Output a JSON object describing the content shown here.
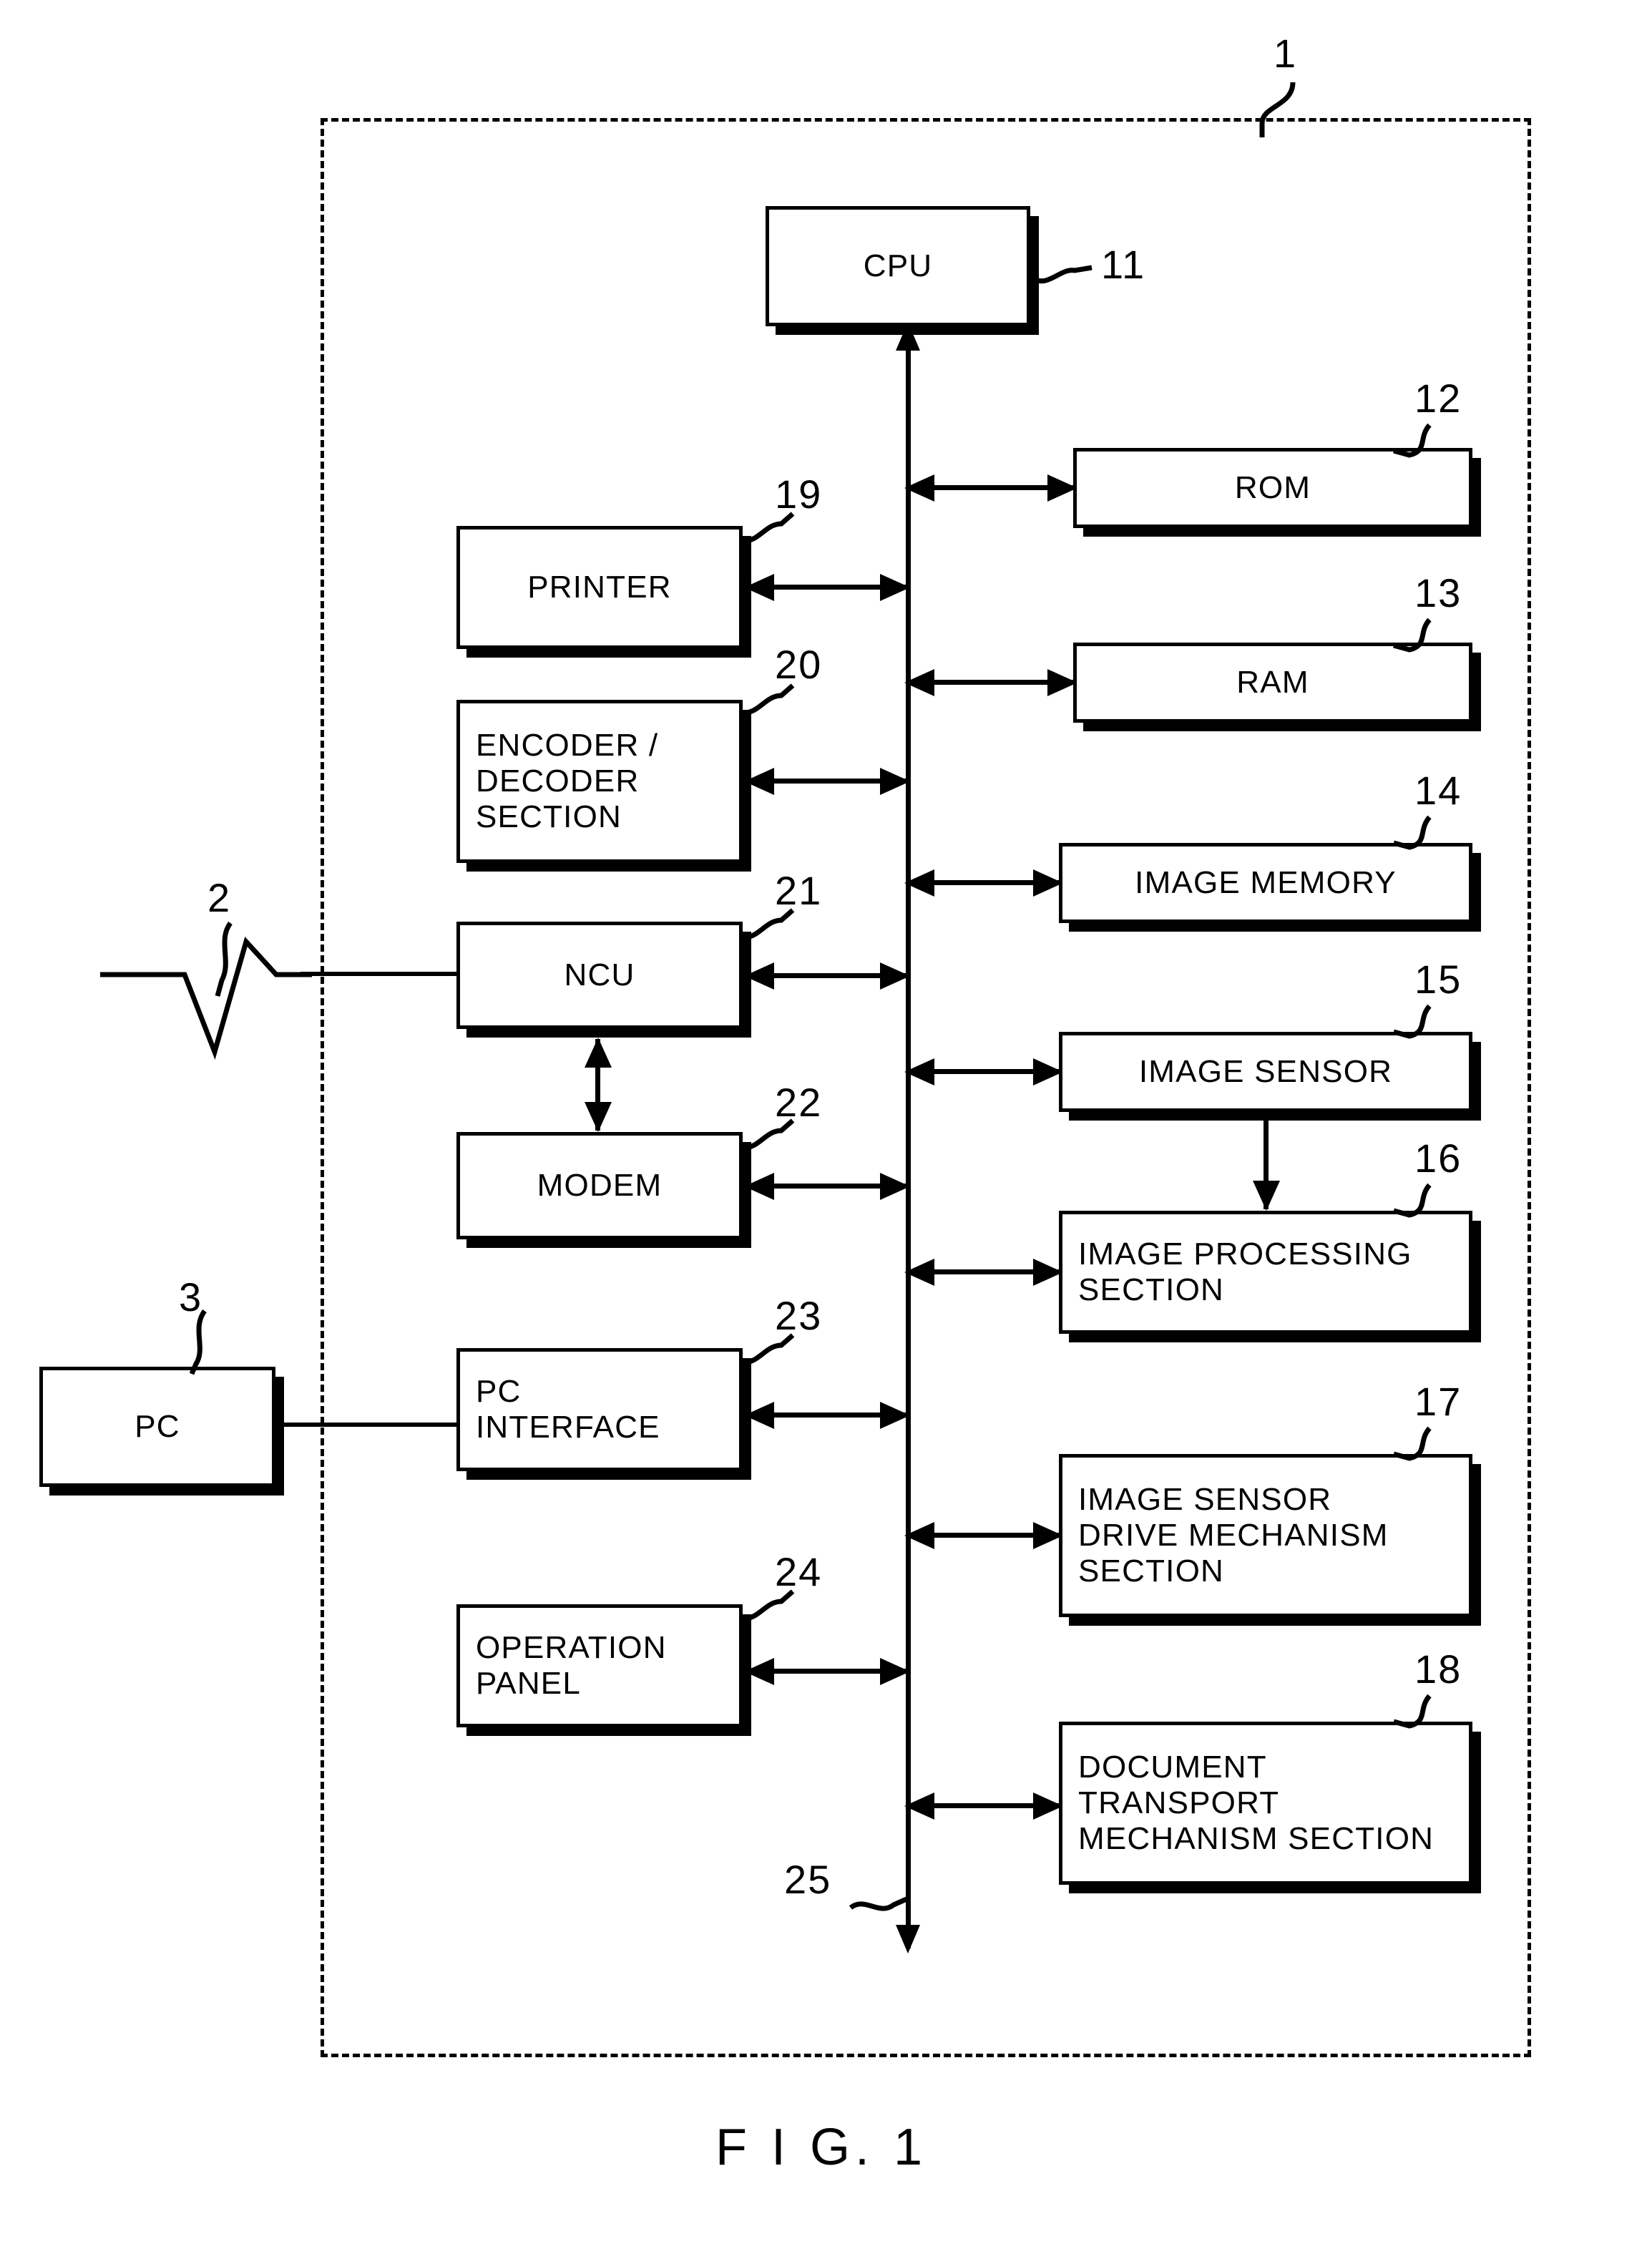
{
  "figure": {
    "caption": "F I G. 1",
    "enclosure_ref": "1"
  },
  "blocks": [
    {
      "id": "cpu",
      "label": "CPU",
      "ref": "11",
      "align": "center"
    },
    {
      "id": "rom",
      "label": "ROM",
      "ref": "12",
      "align": "center"
    },
    {
      "id": "ram",
      "label": "RAM",
      "ref": "13",
      "align": "center"
    },
    {
      "id": "image-memory",
      "label": "IMAGE MEMORY",
      "ref": "14",
      "align": "center"
    },
    {
      "id": "image-sensor",
      "label": "IMAGE SENSOR",
      "ref": "15",
      "align": "center"
    },
    {
      "id": "image-processing",
      "label": "IMAGE PROCESSING\nSECTION",
      "ref": "16",
      "align": "left"
    },
    {
      "id": "sensor-drive",
      "label": "IMAGE SENSOR\nDRIVE MECHANISM\nSECTION",
      "ref": "17",
      "align": "left"
    },
    {
      "id": "doc-transport",
      "label": "DOCUMENT\nTRANSPORT\nMECHANISM SECTION",
      "ref": "18",
      "align": "left"
    },
    {
      "id": "printer",
      "label": "PRINTER",
      "ref": "19",
      "align": "center"
    },
    {
      "id": "encoder-decoder",
      "label": "ENCODER /\nDECODER\nSECTION",
      "ref": "20",
      "align": "left"
    },
    {
      "id": "ncu",
      "label": "NCU",
      "ref": "21",
      "align": "center"
    },
    {
      "id": "modem",
      "label": "MODEM",
      "ref": "22",
      "align": "center"
    },
    {
      "id": "pc-interface",
      "label": "PC\nINTERFACE",
      "ref": "23",
      "align": "left"
    },
    {
      "id": "operation-panel",
      "label": "OPERATION\nPANEL",
      "ref": "24",
      "align": "left"
    },
    {
      "id": "pc",
      "label": "PC",
      "ref": "3",
      "align": "center"
    }
  ],
  "bus": {
    "ref": "25",
    "name": "system-bus"
  },
  "telephone_line": {
    "ref": "2"
  },
  "colors": {
    "ink": "#000000",
    "paper": "#ffffff"
  }
}
